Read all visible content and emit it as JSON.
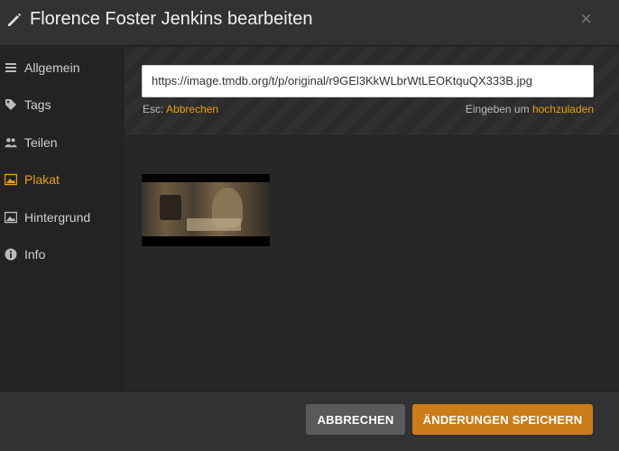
{
  "header": {
    "title": "Florence Foster Jenkins bearbeiten",
    "close_label": "×"
  },
  "sidebar": {
    "items": [
      {
        "label": "Allgemein",
        "icon": "list-icon",
        "active": false
      },
      {
        "label": "Tags",
        "icon": "tag-icon",
        "active": false
      },
      {
        "label": "Teilen",
        "icon": "users-icon",
        "active": false
      },
      {
        "label": "Plakat",
        "icon": "image-icon",
        "active": true
      },
      {
        "label": "Hintergrund",
        "icon": "picture-icon",
        "active": false
      },
      {
        "label": "Info",
        "icon": "info-icon",
        "active": false
      }
    ]
  },
  "upload": {
    "url_value": "https://image.tmdb.org/t/p/original/r9GEl3KkWLbrWtLEOKtquQX333B.jpg",
    "hint_esc_prefix": "Esc: ",
    "hint_esc_action": "Abbrechen",
    "hint_enter_prefix": "Eingeben um ",
    "hint_enter_action": "hochzuladen"
  },
  "footer": {
    "cancel_label": "ABBRECHEN",
    "save_label": "ÄNDERUNGEN SPEICHERN"
  },
  "colors": {
    "accent": "#e5a00d",
    "save_button": "#cc7b19",
    "cancel_button": "#5a5a5a"
  }
}
